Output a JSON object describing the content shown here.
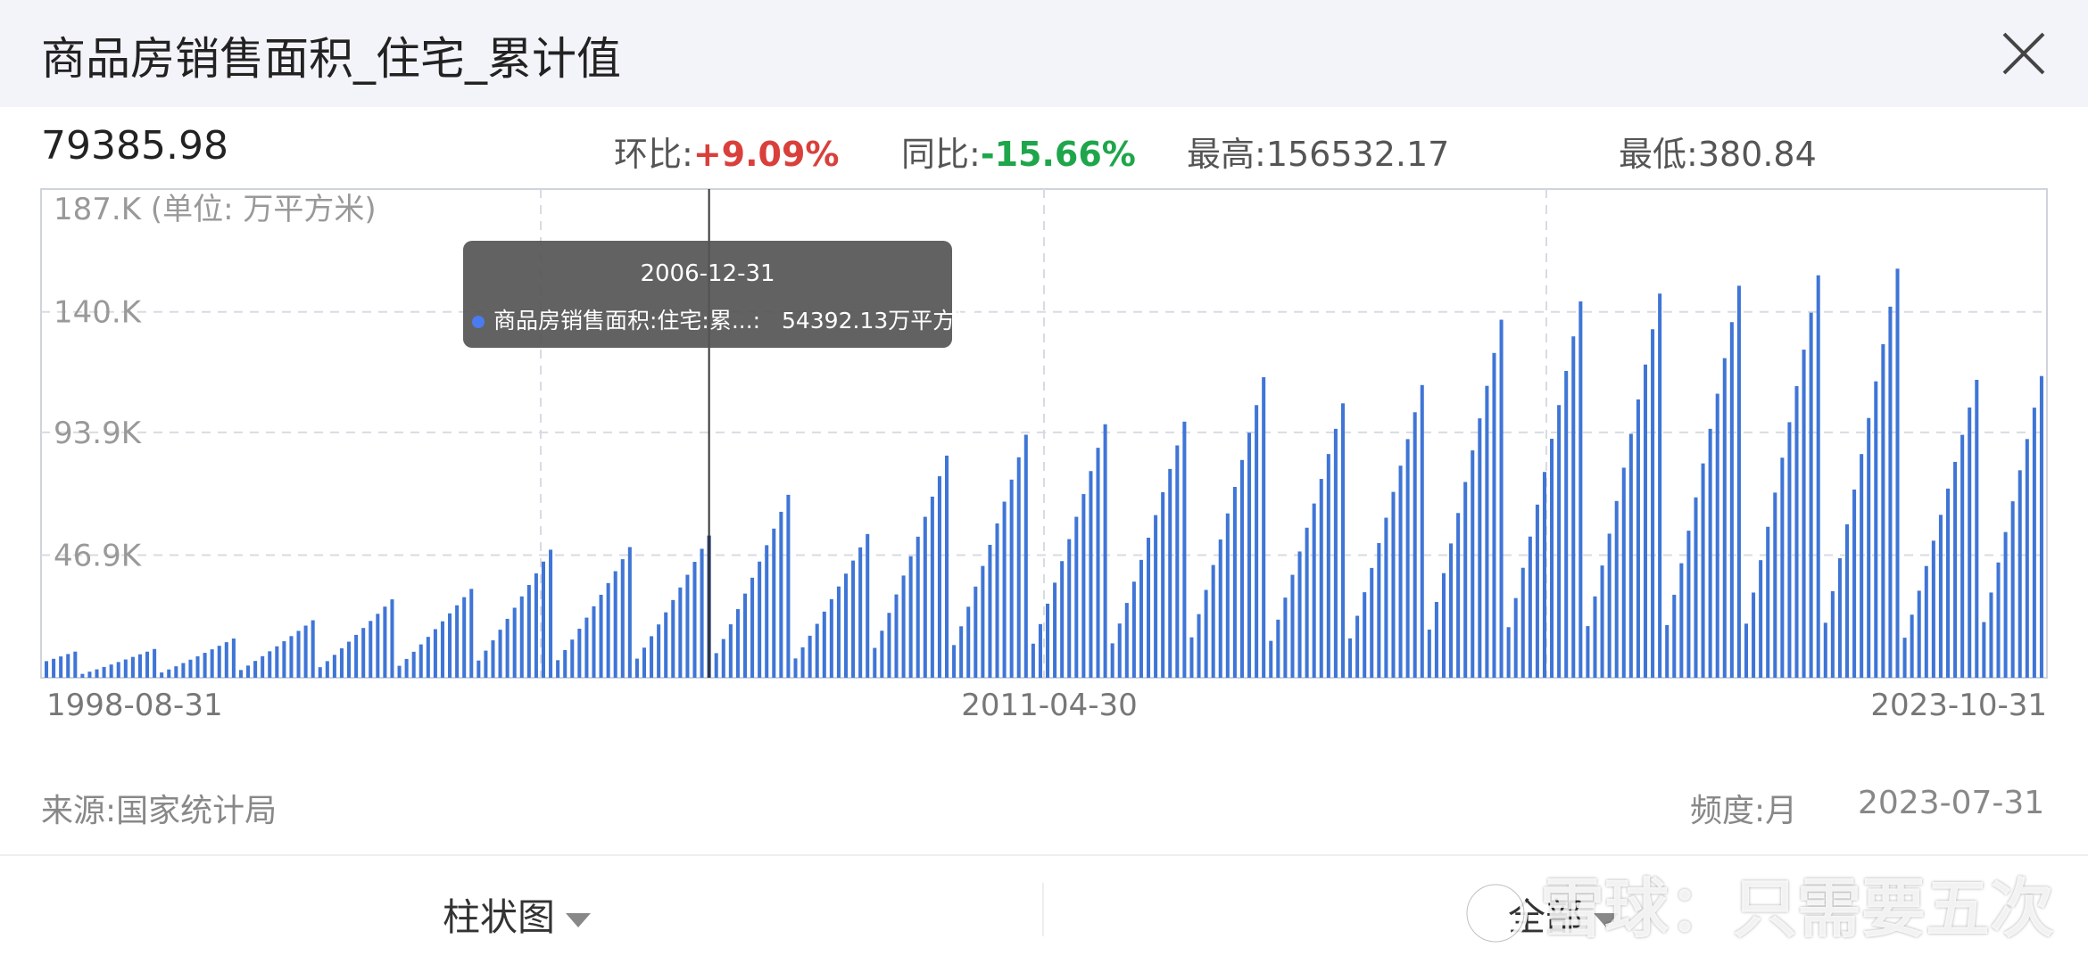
{
  "header": {
    "title": "商品房销售面积_住宅_累计值"
  },
  "summary": {
    "latest_value": "79385.98",
    "mom_label": "环比:",
    "mom_value": "+9.09%",
    "yoy_label": "同比:",
    "yoy_value": "-15.66%",
    "high_label": "最高:",
    "high_value": "156532.17",
    "low_label": "最低:",
    "low_value": "380.84"
  },
  "tooltip": {
    "date": "2006-12-31",
    "series": "商品房销售面积:住宅:累...:",
    "value": "54392.13万平方米"
  },
  "chart_data": {
    "type": "bar",
    "unit_label": "187.K (单位:  万平方米)",
    "yticks": [
      "140.K",
      "93.9K",
      "46.9K"
    ],
    "ytick_values": [
      140000,
      93900,
      46900
    ],
    "ylim": [
      0,
      187000
    ],
    "xticks": [
      "1998-08-31",
      "2011-04-30",
      "2023-10-31"
    ],
    "x_start": "1998-08",
    "x_end": "2023-10",
    "highlight": {
      "date": "2006-12",
      "value": 54392.13
    },
    "annual_cumulative_dec": {
      "1998": 10000,
      "1999": 11000,
      "2000": 15000,
      "2001": 22000,
      "2002": 30000,
      "2003": 34000,
      "2004": 49000,
      "2005": 50000,
      "2006": 54392,
      "2007": 70000,
      "2008": 55000,
      "2009": 85000,
      "2010": 93000,
      "2011": 97000,
      "2012": 98000,
      "2013": 115000,
      "2014": 105000,
      "2015": 112000,
      "2016": 137000,
      "2017": 144000,
      "2018": 147000,
      "2019": 150000,
      "2020": 154000,
      "2021": 156532,
      "2022": 114000,
      "2023": 79386
    },
    "partial_year_2023_last_month": 10
  },
  "footer": {
    "source": "来源:国家统计局",
    "frequency": "频度:月",
    "date": "2023-07-31"
  },
  "controls": {
    "chart_type": "柱状图",
    "range": "全部"
  },
  "watermark": {
    "text": "雪球：只需要五次"
  },
  "colors": {
    "bar": "#3f75d6",
    "up": "#d9403b",
    "down": "#1fa64b"
  }
}
